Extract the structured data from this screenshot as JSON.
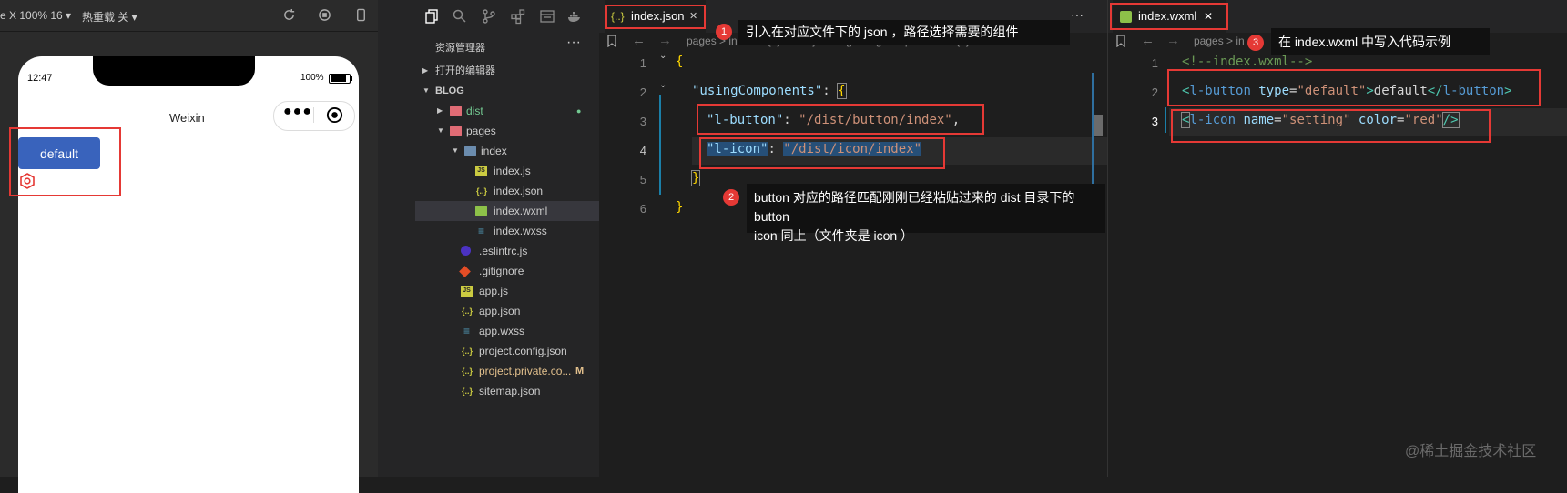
{
  "simulator": {
    "device_label": "e X 100% 16 ▾",
    "hot_reload_label": "热重载 关 ▾",
    "status_time": "12:47",
    "battery_pct": "100%",
    "nav_title": "Weixin",
    "button_label": "default"
  },
  "explorer": {
    "title": "资源管理器",
    "more": "···",
    "open_editors": "打开的编辑器",
    "root": "BLOG",
    "items": [
      {
        "label": "dist",
        "badge": "●"
      },
      {
        "label": "pages"
      },
      {
        "label": "index"
      },
      {
        "label": "index.js"
      },
      {
        "label": "index.json"
      },
      {
        "label": "index.wxml"
      },
      {
        "label": "index.wxss"
      },
      {
        "label": ".eslintrc.js"
      },
      {
        "label": ".gitignore"
      },
      {
        "label": "app.js"
      },
      {
        "label": "app.json"
      },
      {
        "label": "app.wxss"
      },
      {
        "label": "project.config.json"
      },
      {
        "label": "project.private.co...",
        "badge": "M"
      },
      {
        "label": "sitemap.json"
      }
    ],
    "icon_glyphs": {
      "json": "{..}",
      "js": "JS"
    }
  },
  "editor1": {
    "tab_label": "index.json",
    "tab_icon_glyph": "{..}",
    "close_glyph": "✕",
    "more": "···",
    "breadcrumb": "pages > index > {..} index.json > {} usingComponents > {..} l-icon",
    "line_numbers": [
      "1",
      "2",
      "3",
      "4",
      "5",
      "6"
    ],
    "code": {
      "open_brace": "{",
      "key_using": "\"usingComponents\"",
      "colon_sp": ": ",
      "inner_open": "{",
      "key_button": "\"l-button\"",
      "val_button": "\"/dist/button/index\"",
      "comma": ",",
      "key_icon": "\"l-icon\"",
      "val_icon": "\"/dist/icon/index\"",
      "inner_close": "}",
      "close_brace": "}"
    }
  },
  "editor2": {
    "tab_label": "index.wxml",
    "close_glyph": "✕",
    "breadcrumb": "pages > in",
    "line_numbers": [
      "1",
      "2",
      "3"
    ],
    "code": {
      "comment": "<!--index.wxml-->",
      "lt": "<",
      "slash_lt": "</",
      "gt": ">",
      "self_close": "/>",
      "tag_button": "l-button",
      "attr_type": " type",
      "eq": "=",
      "val_default": "\"default\"",
      "text_default": "default",
      "tag_icon": "l-icon",
      "attr_name": " name",
      "val_setting": "\"setting\"",
      "attr_color": " color",
      "val_red": "\"red\""
    }
  },
  "annotations": {
    "n1": {
      "badge": "1",
      "text": "引入在对应文件下的 json ，路径选择需要的组件"
    },
    "n2": {
      "badge": "2",
      "line1": "button 对应的路径匹配刚刚已经粘贴过来的 dist 目录下的 button",
      "line2": "icon 同上（文件夹是 icon ）"
    },
    "n3": {
      "badge": "3",
      "text": "在 index.wxml 中写入代码示例"
    }
  },
  "watermark": "@稀土掘金技术社区",
  "colors": {
    "accent_red": "#e53935",
    "button_blue": "#3963bc",
    "editor_bg": "#1e1e1e"
  }
}
